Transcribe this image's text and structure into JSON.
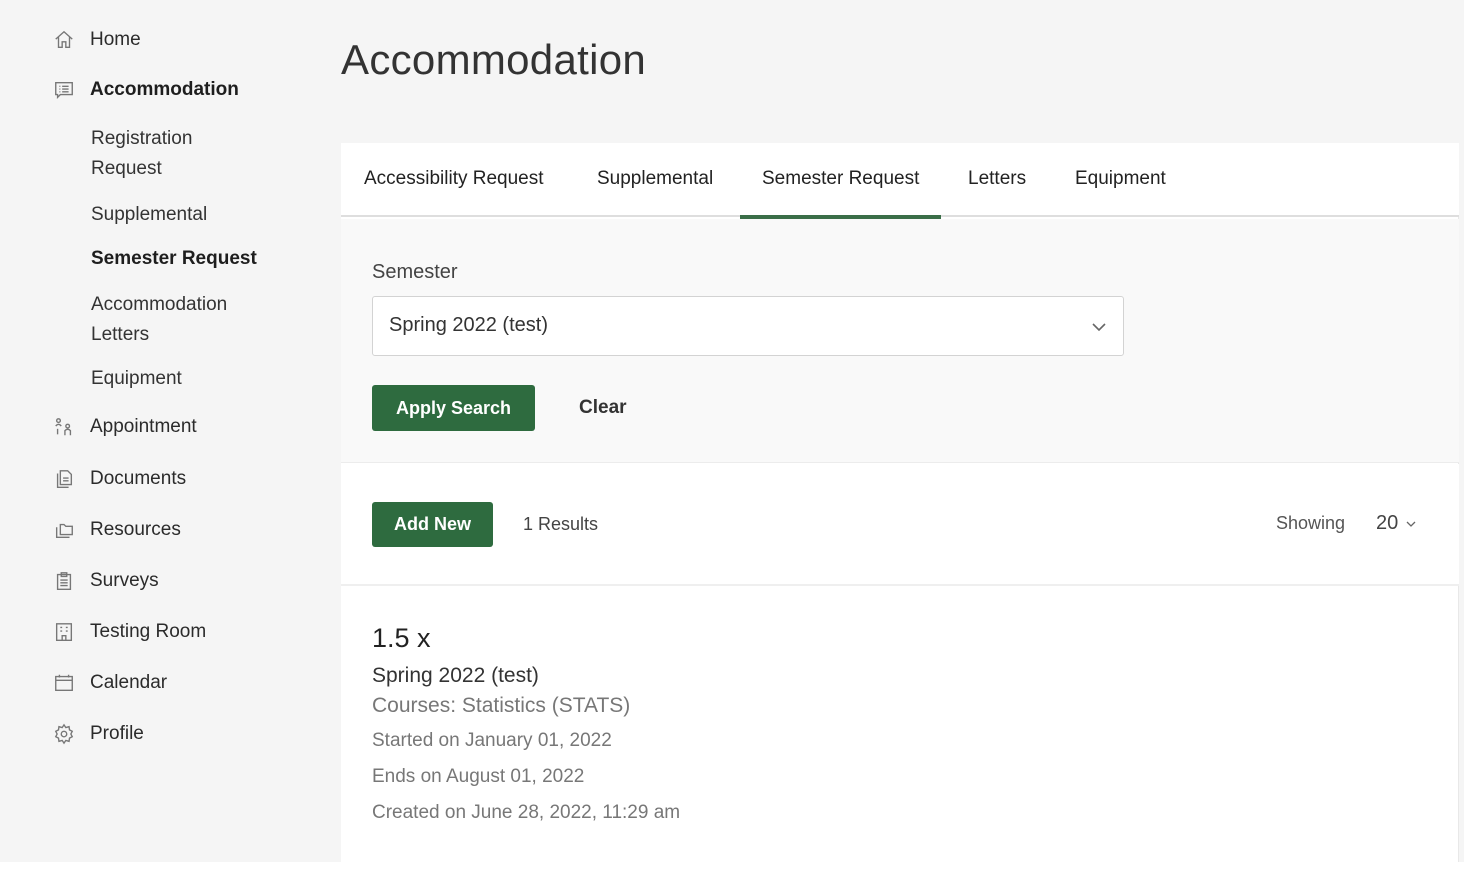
{
  "sidebar": {
    "items": [
      {
        "label": "Home",
        "icon": "home-icon"
      },
      {
        "label": "Accommodation",
        "icon": "list-chat-icon",
        "active": true
      },
      {
        "label": "Appointment",
        "icon": "people-icon"
      },
      {
        "label": "Documents",
        "icon": "documents-icon"
      },
      {
        "label": "Resources",
        "icon": "folders-icon"
      },
      {
        "label": "Surveys",
        "icon": "clipboard-icon"
      },
      {
        "label": "Testing Room",
        "icon": "building-icon"
      },
      {
        "label": "Calendar",
        "icon": "calendar-icon"
      },
      {
        "label": "Profile",
        "icon": "gear-icon"
      }
    ],
    "sub_items": [
      {
        "label_line1": "Registration",
        "label_line2": "Request"
      },
      {
        "label_line1": "Supplemental"
      },
      {
        "label_line1": "Semester Request",
        "active": true
      },
      {
        "label_line1": "Accommodation",
        "label_line2": "Letters"
      },
      {
        "label_line1": "Equipment"
      }
    ]
  },
  "main": {
    "title": "Accommodation",
    "tabs": [
      {
        "label": "Accessibility Request"
      },
      {
        "label": "Supplemental"
      },
      {
        "label": "Semester Request",
        "active": true
      },
      {
        "label": "Letters"
      },
      {
        "label": "Equipment"
      }
    ],
    "filter": {
      "semester_label": "Semester",
      "semester_value": "Spring 2022 (test)",
      "apply_label": "Apply Search",
      "clear_label": "Clear"
    },
    "results": {
      "add_new_label": "Add New",
      "count_text": "1 Results",
      "showing_label": "Showing",
      "page_size": "20"
    },
    "items": [
      {
        "title": "1.5 x",
        "semester": "Spring 2022 (test)",
        "courses": "Courses: Statistics (STATS)",
        "started": "Started on January 01, 2022",
        "ends": "Ends on August 01, 2022",
        "created": "Created on June 28, 2022, 11:29 am"
      }
    ]
  },
  "colors": {
    "accent": "#2e6b3f",
    "tab_underline": "#3a6e48",
    "background": "#f5f5f5"
  }
}
